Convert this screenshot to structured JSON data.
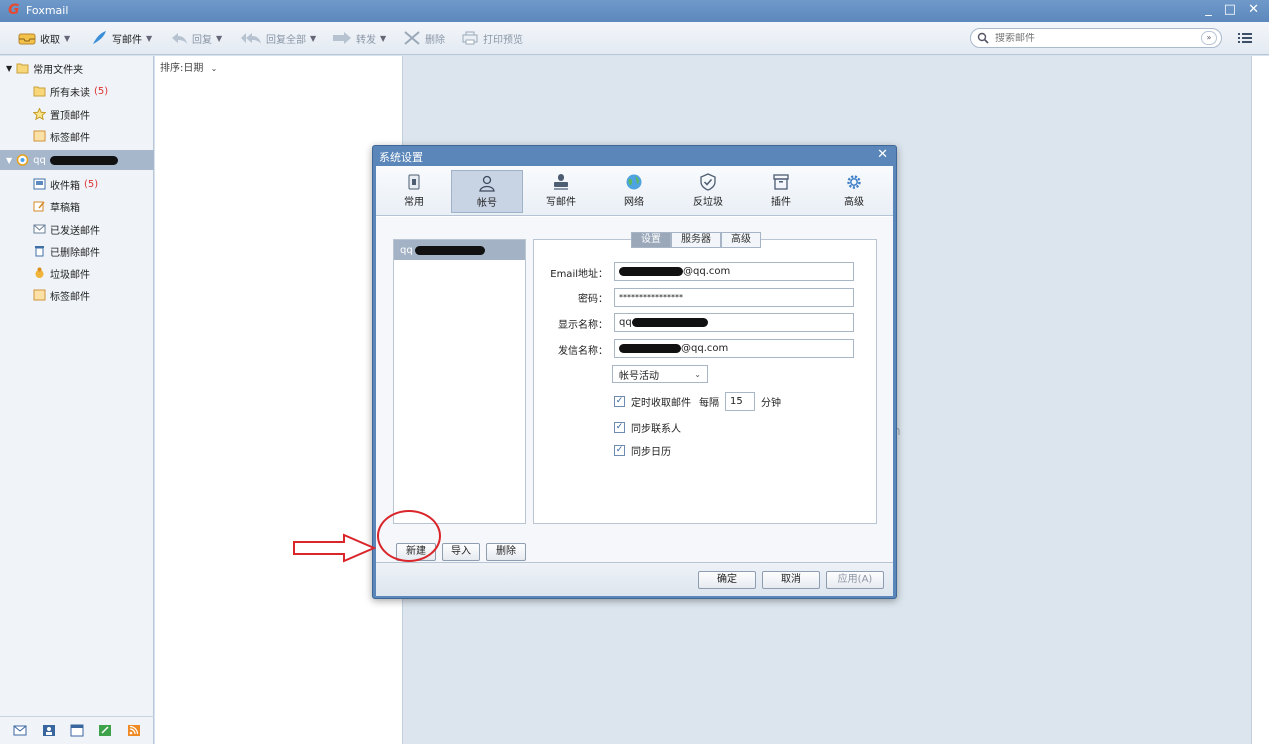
{
  "window": {
    "title": "Foxmail",
    "controls": [
      "_",
      "□",
      "✕"
    ]
  },
  "toolbar": {
    "receive": "收取",
    "compose": "写邮件",
    "reply": "回复",
    "reply_all": "回复全部",
    "forward": "转发",
    "delete": "删除",
    "print_preview": "打印预览",
    "search_placeholder": "搜索邮件"
  },
  "sidebar": {
    "common_folder": "常用文件夹",
    "all_unread": "所有未读",
    "all_unread_count": "(5)",
    "pinned": "置顶邮件",
    "flagged": "标签邮件",
    "account_prefix": "qq",
    "inbox": "收件箱",
    "inbox_count": "(5)",
    "drafts": "草稿箱",
    "sent": "已发送邮件",
    "deleted": "已删除邮件",
    "junk": "垃圾邮件",
    "tags": "标签邮件"
  },
  "list": {
    "sort_label": "排序:日期"
  },
  "content": {
    "ghost_char": "n"
  },
  "dialog": {
    "title": "系统设置",
    "close": "✕",
    "tabs": [
      "常用",
      "帐号",
      "写邮件",
      "网络",
      "反垃圾",
      "插件",
      "高级"
    ],
    "account_item": "qq",
    "subtabs": [
      "设置",
      "服务器",
      "高级"
    ],
    "fields": {
      "email_label": "Email地址：",
      "email_suffix": "@qq.com",
      "password_label": "密码：",
      "password_value": "****************",
      "display_label": "显示名称：",
      "display_prefix": "qq",
      "sender_label": "发信名称：",
      "sender_suffix": "@qq.com"
    },
    "account_status": "帐号活动",
    "options": {
      "timed_receive": "定时收取邮件",
      "every": "每隔",
      "interval": "15",
      "minutes": "分钟",
      "sync_contacts": "同步联系人",
      "sync_calendar": "同步日历"
    },
    "buttons": {
      "new": "新建",
      "import": "导入",
      "delete": "删除"
    },
    "footer": {
      "ok": "确定",
      "cancel": "取消",
      "apply": "应用(A)"
    }
  }
}
